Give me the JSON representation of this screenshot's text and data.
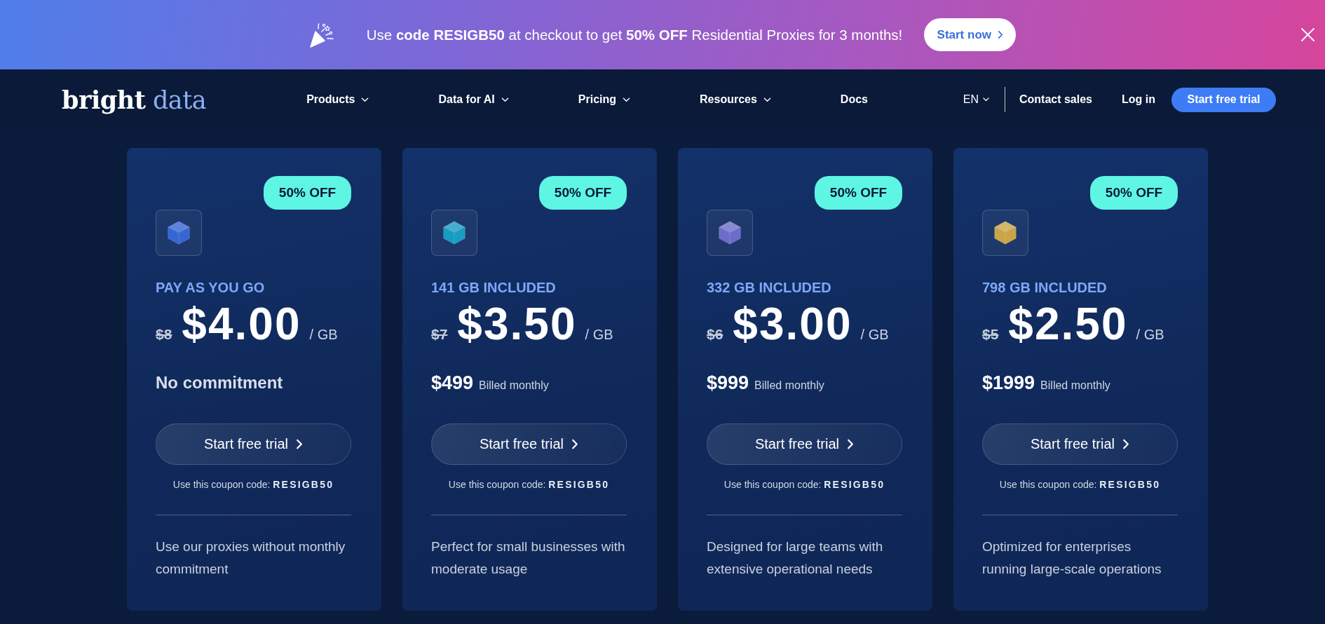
{
  "promo_banner": {
    "message": "Use **code RESIGB50** at checkout to get **50% OFF** Residential Proxies for 3 months!",
    "button": "Start now"
  },
  "nav": {
    "logo": {
      "word_1": "bright",
      "word_2": "data"
    },
    "menu": [
      {
        "label": "Products",
        "has_menu": true
      },
      {
        "label": "Data for AI",
        "has_menu": true
      },
      {
        "label": "Pricing",
        "has_menu": true
      },
      {
        "label": "Resources",
        "has_menu": true
      },
      {
        "label": "Docs",
        "has_menu": false
      }
    ],
    "language": "EN",
    "contact": "Contact sales",
    "login": "Log in",
    "cta": "Start free trial"
  },
  "plans": [
    {
      "badge": "50% OFF",
      "color": "#3566d4",
      "label": "PAY AS YOU GO",
      "old_price": "$8",
      "price": "$4.00",
      "unit": "/ GB",
      "kind": "note",
      "note": "No commitment",
      "button": "Start free trial",
      "coupon": "Use this coupon code: **RESIGB50**",
      "description_lines": [
        "Use our proxies without monthly",
        "commitment"
      ]
    },
    {
      "badge": "50% OFF",
      "color": "#189cc4",
      "label": "141 GB INCLUDED",
      "old_price": "$7",
      "price": "$3.50",
      "unit": "/ GB",
      "kind": "billing",
      "amount": "$499",
      "period": "Billed monthly",
      "button": "Start free trial",
      "coupon": "Use this coupon code: **RESIGB50**",
      "description_lines": [
        "Perfect for small businesses with",
        "moderate usage"
      ]
    },
    {
      "badge": "50% OFF",
      "color": "#6b6dc9",
      "label": "332 GB INCLUDED",
      "old_price": "$6",
      "price": "$3.00",
      "unit": "/ GB",
      "kind": "billing",
      "amount": "$999",
      "period": "Billed monthly",
      "button": "Start free trial",
      "coupon": "Use this coupon code: **RESIGB50**",
      "description_lines": [
        "Designed for large teams with",
        "extensive operational needs"
      ]
    },
    {
      "badge": "50% OFF",
      "color": "#c9a545",
      "label": "798 GB INCLUDED",
      "old_price": "$5",
      "price": "$2.50",
      "unit": "/ GB",
      "kind": "billing",
      "amount": "$1999",
      "period": "Billed monthly",
      "button": "Start free trial",
      "coupon": "Use this coupon code: **RESIGB50**",
      "description_lines": [
        "Optimized for enterprises",
        "running large-scale operations"
      ]
    }
  ]
}
